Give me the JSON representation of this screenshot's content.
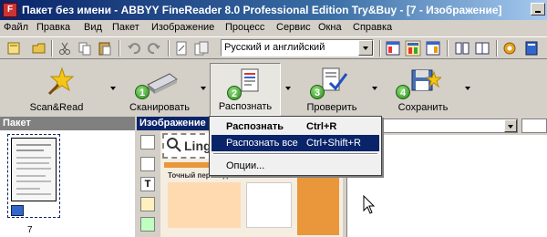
{
  "window": {
    "title": "Пакет без имени - ABBYY FineReader 8.0 Professional Edition Try&Buy - [7 - Изображение]"
  },
  "menu": [
    "Файл",
    "Правка",
    "Вид",
    "Пакет",
    "Изображение",
    "Процесс",
    "Сервис",
    "Окна",
    "Справка"
  ],
  "toolbar": {
    "language_value": "Русский и английский"
  },
  "actions": {
    "scan_read": "Scan&Read",
    "scan": "Сканировать",
    "recognize": "Распознать",
    "check": "Проверить",
    "save": "Сохранить",
    "steps": [
      "1",
      "2",
      "3",
      "4"
    ]
  },
  "panels": {
    "batch_title": "Пакет",
    "image_title": "Изображение",
    "page_number": "7"
  },
  "document": {
    "logo_text": "Lingvo",
    "heading": "Точный перевод любого слова"
  },
  "popup_menu": {
    "items": [
      {
        "label": "Распознать",
        "shortcut": "Ctrl+R"
      },
      {
        "label": "Распознать все",
        "shortcut": "Ctrl+Shift+R"
      },
      {
        "label": "Опции...",
        "shortcut": ""
      }
    ]
  },
  "colors": {
    "titlebar": "#0a246a",
    "selection": "#0a246a",
    "face": "#d4d0c8"
  }
}
